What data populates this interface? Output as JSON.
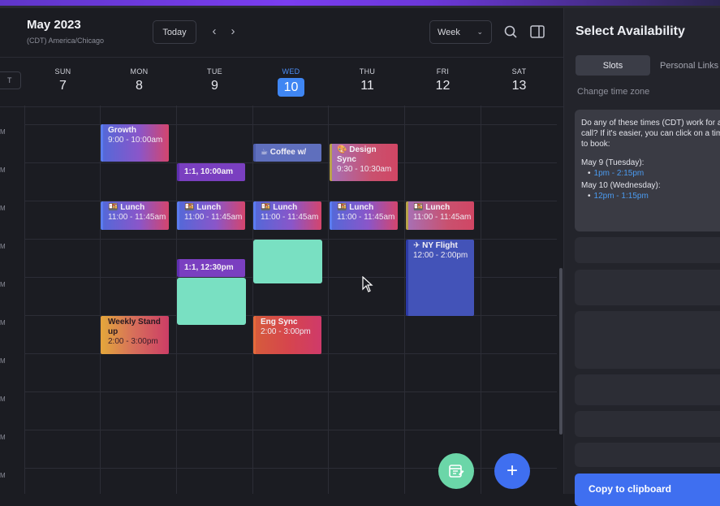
{
  "header": {
    "month_title": "May 2023",
    "timezone": "(CDT) America/Chicago",
    "today_label": "Today",
    "prev_icon": "‹",
    "next_icon": "›",
    "view_label": "Week",
    "view_chevron": "⌄",
    "icons": [
      "search-icon",
      "sidebar-toggle-icon"
    ]
  },
  "time_chip": "T",
  "days": [
    {
      "dow": "SUN",
      "num": "7"
    },
    {
      "dow": "MON",
      "num": "8"
    },
    {
      "dow": "TUE",
      "num": "9"
    },
    {
      "dow": "WED",
      "num": "10"
    },
    {
      "dow": "THU",
      "num": "11"
    },
    {
      "dow": "FRI",
      "num": "12"
    },
    {
      "dow": "SAT",
      "num": "13"
    }
  ],
  "hour_labels": [
    "M",
    "M",
    "M",
    "M",
    "M",
    "M",
    "M",
    "M",
    "M",
    "M"
  ],
  "events": {
    "growth": {
      "title": "Growth",
      "time": "9:00 - 10:00am"
    },
    "one_on_one_1": {
      "title": "1:1, 10:00am"
    },
    "coffee": {
      "title": "☕ Coffee w/"
    },
    "design_sync": {
      "title": "🎨 Design Sync",
      "time": "9:30 - 10:30am"
    },
    "lunch_mon": {
      "title": "🍱 Lunch",
      "time": "11:00 - 11:45am"
    },
    "lunch_tue": {
      "title": "🍱 Lunch",
      "time": "11:00 - 11:45am"
    },
    "lunch_wed": {
      "title": "🍱 Lunch",
      "time": "11:00 - 11:45am"
    },
    "lunch_thu": {
      "title": "🍱 Lunch",
      "time": "11:00 - 11:45am"
    },
    "lunch_fri": {
      "title": "🍱 Lunch",
      "time": "11:00 - 11:45am"
    },
    "ny_flight": {
      "title": "✈ NY Flight",
      "time": "12:00 - 2:00pm"
    },
    "one_on_one_2": {
      "title": "1:1, 12:30pm"
    },
    "weekly_standup": {
      "title": "Weekly Stand up",
      "time": "2:00 - 3:00pm"
    },
    "eng_sync": {
      "title": "Eng Sync",
      "time": "2:00 - 3:00pm"
    }
  },
  "fab": {
    "plus": "+"
  },
  "panel": {
    "title": "Select Availability",
    "tab_slots": "Slots",
    "tab_links": "Personal Links",
    "change_tz": "Change time zone",
    "intro": "Do any of these times (CDT) work for a call? If it's easier, you can click on a time to book:",
    "day1": "May 9 (Tuesday):",
    "slot1": "1pm - 2:15pm",
    "day2": "May 10 (Wednesday):",
    "slot2": "12pm - 1:15pm",
    "copy_label": "Copy to clipboard"
  },
  "colors": {
    "accent": "#3f86f3",
    "mint": "#79e0c2",
    "purple": "#7a3fc0",
    "fab_green": "#6bd6a8",
    "fab_blue": "#3f6ff0"
  }
}
